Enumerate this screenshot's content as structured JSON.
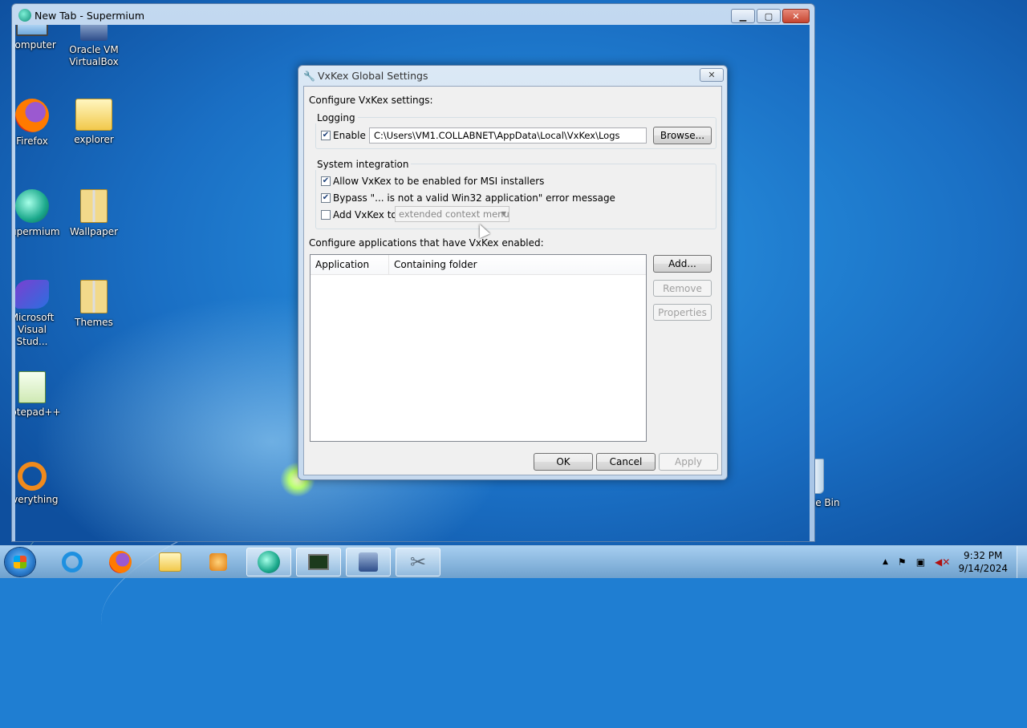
{
  "browser": {
    "title": "New Tab - Supermium"
  },
  "desktop_icons_left": [
    {
      "label": "Computer",
      "icon": "computer-icon"
    },
    {
      "label": "Firefox",
      "icon": "firefox-icon"
    },
    {
      "label": "Supermium",
      "icon": "supermium-icon"
    },
    {
      "label": "Microsoft Visual Stud...",
      "icon": "visual-studio-icon"
    },
    {
      "label": "Notepad++",
      "icon": "notepad-plus-plus-icon"
    },
    {
      "label": "Everything",
      "icon": "everything-icon"
    }
  ],
  "desktop_icons_right": [
    {
      "label": "Oracle VM VirtualBox",
      "icon": "virtualbox-icon"
    },
    {
      "label": "explorer",
      "icon": "folder-icon"
    },
    {
      "label": "Wallpaper",
      "icon": "zip-folder-icon"
    },
    {
      "label": "Themes",
      "icon": "zip-folder-icon"
    }
  ],
  "recycle_bin": {
    "label": "Recycle Bin"
  },
  "dialog": {
    "title": "VxKex Global Settings",
    "close_glyph": "✕",
    "intro": "Configure VxKex settings:",
    "logging": {
      "group_label": "Logging",
      "enable_label": "Enable",
      "enable_checked": true,
      "path": "C:\\Users\\VM1.COLLABNET\\AppData\\Local\\VxKex\\Logs",
      "browse_label": "Browse..."
    },
    "system_integration": {
      "group_label": "System integration",
      "msi_label": "Allow VxKex to be enabled for MSI installers",
      "msi_checked": true,
      "bypass_label": "Bypass \"... is not a valid Win32 application\" error message",
      "bypass_checked": true,
      "add_label": "Add VxKex to:",
      "add_checked": false,
      "context_menu_value": "extended context menu"
    },
    "apps": {
      "label": "Configure applications that have VxKex enabled:",
      "columns": [
        "Application",
        "Containing folder"
      ],
      "add_label": "Add...",
      "remove_label": "Remove",
      "properties_label": "Properties"
    },
    "ok_label": "OK",
    "cancel_label": "Cancel",
    "apply_label": "Apply"
  },
  "taskbar": {
    "items": [
      "ie-icon",
      "firefox-icon",
      "explorer-icon",
      "media-player-icon",
      "supermium-icon",
      "terminal-icon",
      "virtualbox-icon",
      "tools-icon"
    ],
    "time": "9:32 PM",
    "date": "9/14/2024"
  }
}
